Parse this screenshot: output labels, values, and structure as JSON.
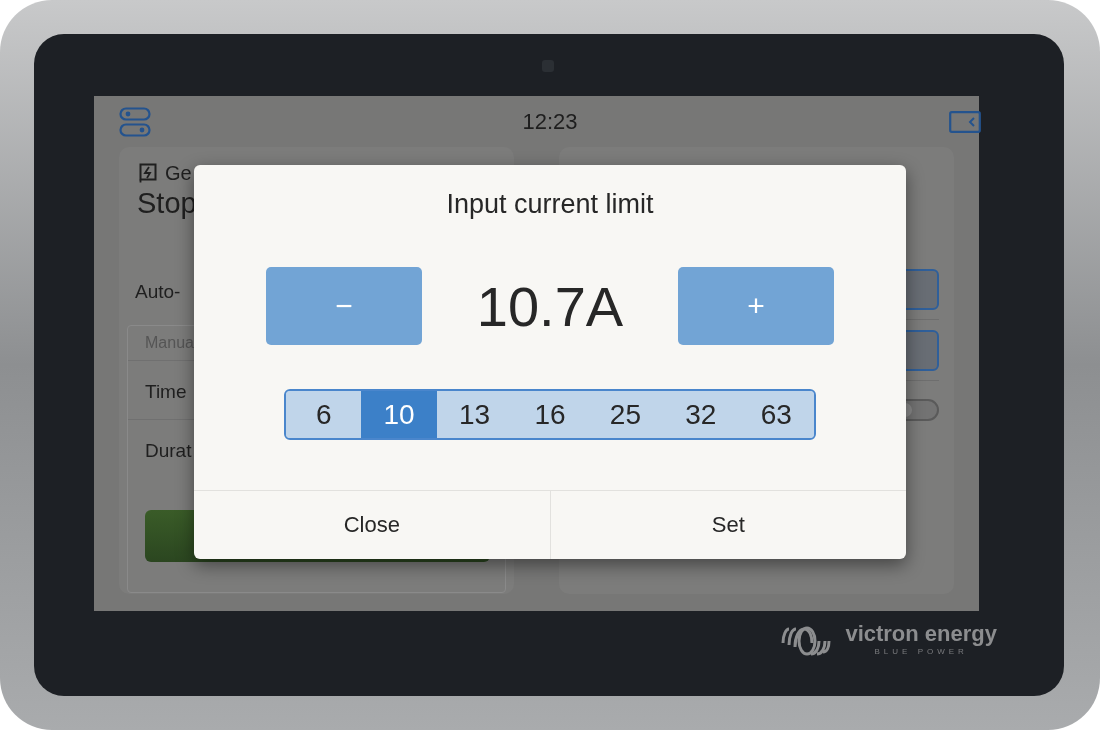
{
  "status_bar": {
    "time": "12:23"
  },
  "generator_card": {
    "title": "Ge",
    "state": "Stop",
    "auto_start_label": "Auto-",
    "section_header": "Manua",
    "rows": [
      "Time",
      "Durat"
    ]
  },
  "side_card": {
    "toggle": {
      "on": false
    }
  },
  "dialog": {
    "title": "Input current limit",
    "decrement": "−",
    "value": "10.7A",
    "increment": "+",
    "presets": [
      {
        "label": "6",
        "selected": false
      },
      {
        "label": "10",
        "selected": true
      },
      {
        "label": "13",
        "selected": false
      },
      {
        "label": "16",
        "selected": false
      },
      {
        "label": "25",
        "selected": false
      },
      {
        "label": "32",
        "selected": false
      },
      {
        "label": "63",
        "selected": false
      }
    ],
    "buttons": [
      "Close",
      "Set"
    ]
  },
  "brand": {
    "name": "victron energy",
    "tagline": "BLUE POWER"
  }
}
